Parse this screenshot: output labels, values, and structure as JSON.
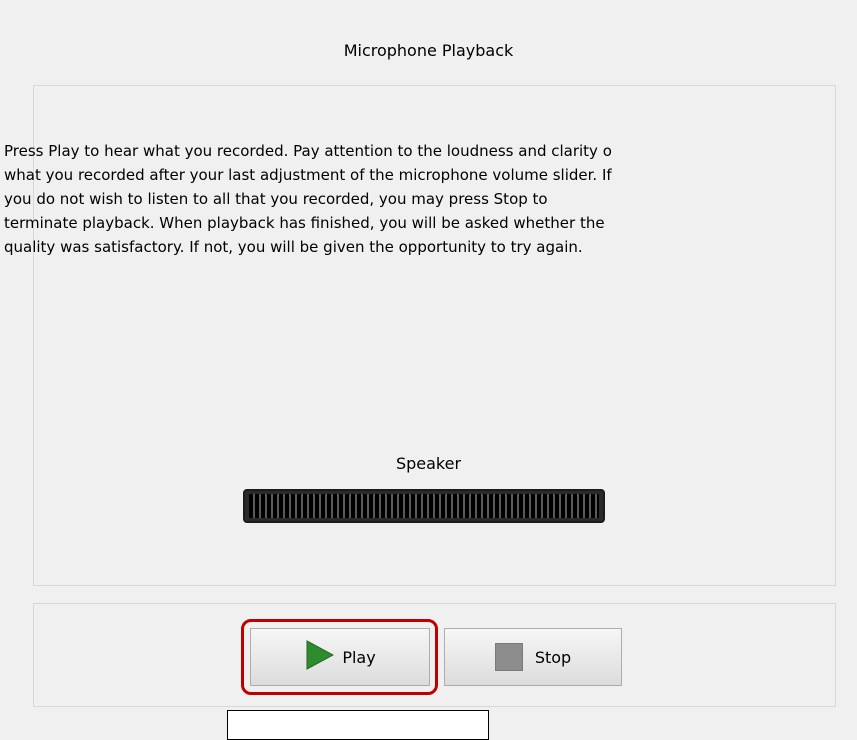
{
  "window": {
    "title": "Microphone Playback"
  },
  "instructions": "Press Play to hear what you recorded. Pay attention to the loudness and clarity o\nwhat you recorded after your last adjustment of the microphone volume slider. If\nyou do not wish to listen to all that you recorded, you may press Stop to\nterminate playback. When playback has finished, you will be asked whether the\nquality was satisfactory.  If not, you will be given the opportunity to try again.",
  "speaker": {
    "label": "Speaker",
    "level": 0
  },
  "buttons": {
    "play_label": "Play",
    "stop_label": "Stop"
  },
  "colors": {
    "play_icon": "#2e8b2e",
    "stop_icon": "#8c8c8c",
    "focus_highlight": "#c00000"
  },
  "icons": {
    "play": "play-icon",
    "stop": "stop-icon"
  }
}
